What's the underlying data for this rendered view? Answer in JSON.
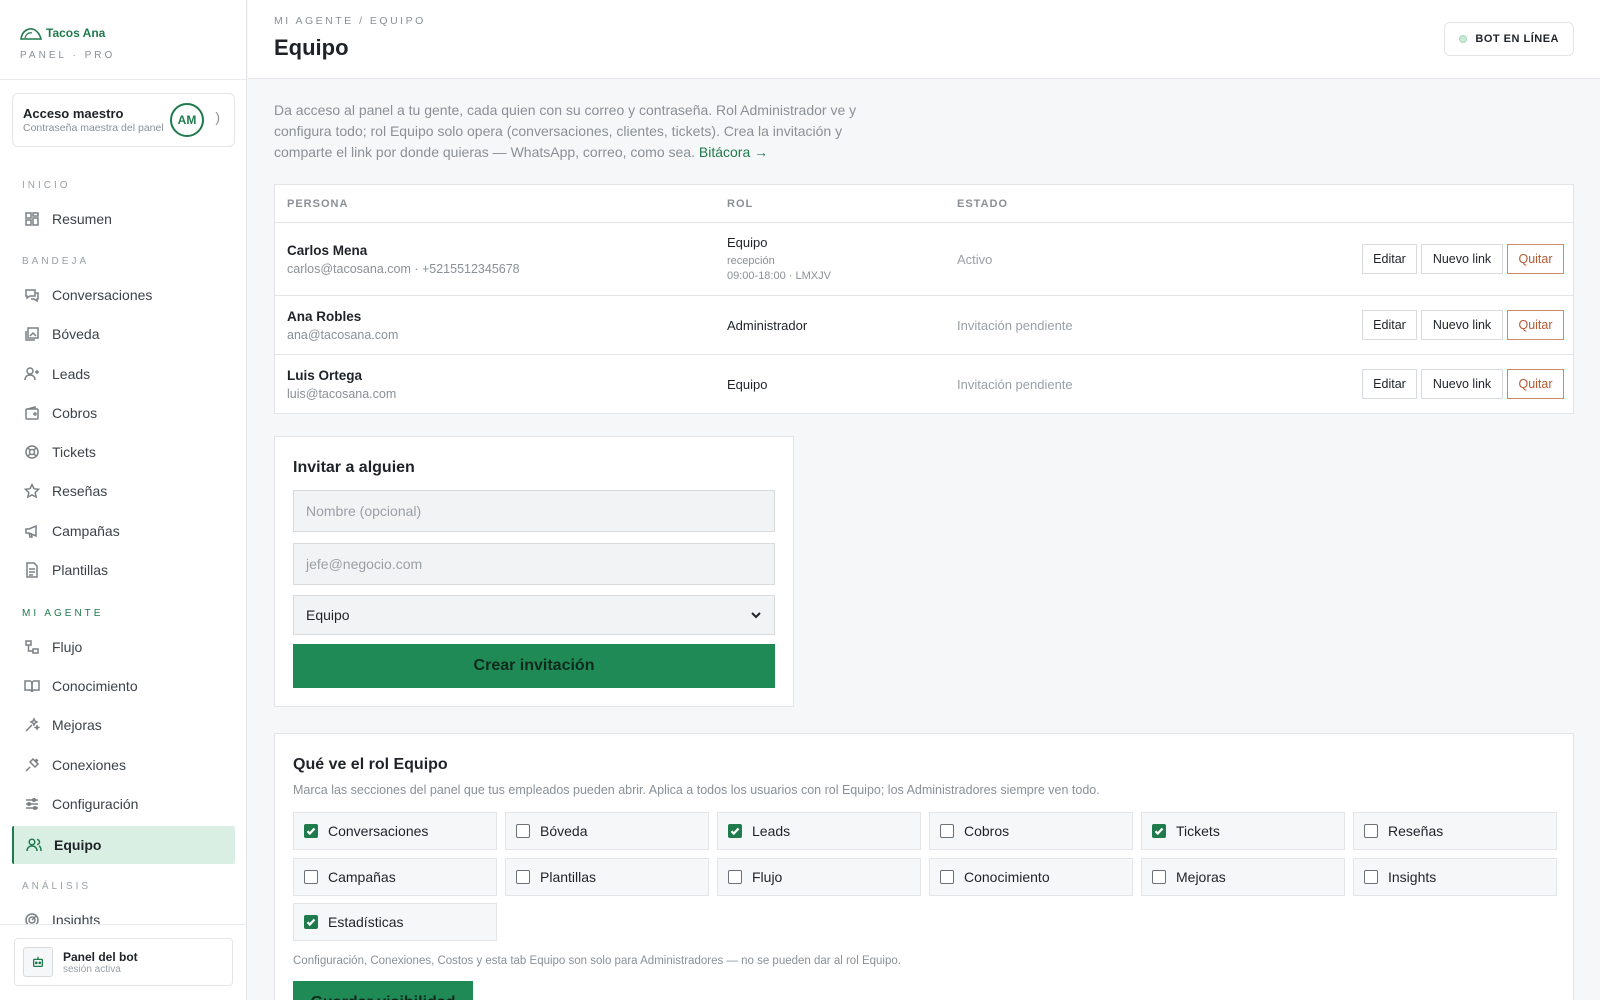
{
  "brand": {
    "name": "Tacos Ana",
    "sub": "PANEL · PRO"
  },
  "master": {
    "title": "Acceso maestro",
    "subtitle": "Contraseña maestra del panel",
    "initials": "AM",
    "paren": ")"
  },
  "nav": {
    "sections": {
      "inicio": "INICIO",
      "bandeja": "BANDEJA",
      "agente": "MI AGENTE",
      "analisis": "ANÁLISIS"
    },
    "items": [
      {
        "label": "Resumen",
        "icon": "grid-icon"
      },
      {
        "label": "Conversaciones",
        "icon": "chat-icon"
      },
      {
        "label": "Bóveda",
        "icon": "image-stack-icon"
      },
      {
        "label": "Leads",
        "icon": "user-plus-icon"
      },
      {
        "label": "Cobros",
        "icon": "wallet-icon"
      },
      {
        "label": "Tickets",
        "icon": "lifebuoy-icon"
      },
      {
        "label": "Reseñas",
        "icon": "star-icon"
      },
      {
        "label": "Campañas",
        "icon": "megaphone-icon"
      },
      {
        "label": "Plantillas",
        "icon": "document-icon"
      },
      {
        "label": "Flujo",
        "icon": "flow-icon"
      },
      {
        "label": "Conocimiento",
        "icon": "book-icon"
      },
      {
        "label": "Mejoras",
        "icon": "sparkle-icon"
      },
      {
        "label": "Conexiones",
        "icon": "plug-icon"
      },
      {
        "label": "Configuración",
        "icon": "sliders-icon"
      },
      {
        "label": "Equipo",
        "icon": "users-icon"
      },
      {
        "label": "Insights",
        "icon": "radar-icon"
      }
    ]
  },
  "bot_panel": {
    "title": "Panel del bot",
    "sub": "sesión activa"
  },
  "header": {
    "breadcrumb": "MI AGENTE / EQUIPO",
    "title": "Equipo",
    "status": "BOT EN LÍNEA"
  },
  "intro": {
    "text": "Da acceso al panel a tu gente, cada quien con su correo y contraseña. Rol Administrador ve y configura todo; rol Equipo solo opera (conversaciones, clientes, tickets). Crea la invitación y comparte el link por donde quieras — WhatsApp, correo, como sea. ",
    "link": "Bitácora →"
  },
  "table": {
    "headers": {
      "person": "PERSONA",
      "role": "ROL",
      "state": "ESTADO"
    },
    "actions": {
      "edit": "Editar",
      "new_link": "Nuevo link",
      "remove": "Quitar"
    },
    "rows": [
      {
        "name": "Carlos Mena",
        "email": "carlos@tacosana.com · +5215512345678",
        "role": "Equipo",
        "role_area": "recepción",
        "role_hours": "09:00-18:00 · LMXJV",
        "state": "Activo"
      },
      {
        "name": "Ana Robles",
        "email": "ana@tacosana.com",
        "role": "Administrador",
        "state": "Invitación pendiente"
      },
      {
        "name": "Luis Ortega",
        "email": "luis@tacosana.com",
        "role": "Equipo",
        "state": "Invitación pendiente"
      }
    ]
  },
  "invite": {
    "title": "Invitar a alguien",
    "name_placeholder": "Nombre (opcional)",
    "email_placeholder": "jefe@negocio.com",
    "role_value": "Equipo",
    "submit": "Crear invitación"
  },
  "visibility": {
    "title": "Qué ve el rol Equipo",
    "description": "Marca las secciones del panel que tus empleados pueden abrir. Aplica a todos los usuarios con rol Equipo; los Administradores siempre ven todo.",
    "options": [
      {
        "label": "Conversaciones",
        "checked": true
      },
      {
        "label": "Bóveda",
        "checked": false
      },
      {
        "label": "Leads",
        "checked": true
      },
      {
        "label": "Cobros",
        "checked": false
      },
      {
        "label": "Tickets",
        "checked": true
      },
      {
        "label": "Reseñas",
        "checked": false
      },
      {
        "label": "Campañas",
        "checked": false
      },
      {
        "label": "Plantillas",
        "checked": false
      },
      {
        "label": "Flujo",
        "checked": false
      },
      {
        "label": "Conocimiento",
        "checked": false
      },
      {
        "label": "Mejoras",
        "checked": false
      },
      {
        "label": "Insights",
        "checked": false
      },
      {
        "label": "Estadísticas",
        "checked": true
      }
    ],
    "note": "Configuración, Conexiones, Costos y esta tab Equipo son solo para Administradores — no se pueden dar al rol Equipo.",
    "save": "Guardar visibilidad"
  },
  "colors": {
    "accent": "#1f7a4c",
    "button": "#1f8a55",
    "danger": "#b35a34",
    "active_bg": "#d9efe4"
  }
}
